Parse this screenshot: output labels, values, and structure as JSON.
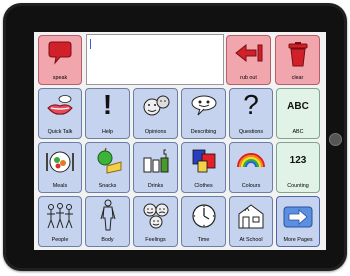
{
  "toolbar": {
    "speak": "speak",
    "rub_out": "rub out",
    "clear": "clear"
  },
  "grid": {
    "quick_talk": "Quick Talk",
    "help": "Help",
    "opinions": "Opinions",
    "describing": "Describing",
    "questions": "Questions",
    "abc": "ABC",
    "meals": "Meals",
    "snacks": "Snacks",
    "drinks": "Drinks",
    "clothes": "Clothes",
    "colours": "Colours",
    "counting": "Counting",
    "people": "People",
    "body": "Body",
    "feelings": "Feelings",
    "time": "Time",
    "at_school": "At School",
    "more_pages": "More Pages"
  },
  "symbols": {
    "help_glyph": "!",
    "questions_glyph": "?",
    "abc_glyph": "ABC",
    "counting_glyph": "123"
  },
  "colors": {
    "category_cell": "#c6d3ee",
    "red_cell": "#f1a6ae",
    "green_cell": "#e1f3e6",
    "text_caret": "#3a5bd8"
  }
}
